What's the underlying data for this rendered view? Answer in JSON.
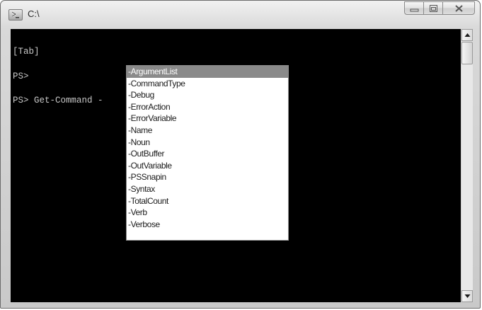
{
  "window": {
    "title": "C:\\",
    "icon": "powershell-icon"
  },
  "caption_buttons": {
    "minimize_icon": "minimize-icon",
    "maximize_icon": "maximize-icon",
    "close_icon": "close-icon"
  },
  "console": {
    "lines": [
      "[Tab]",
      "PS>",
      "PS> Get-Command -"
    ],
    "background": "#000000",
    "foreground": "#c8c8c8"
  },
  "completion": {
    "selected_index": 0,
    "items": [
      "-ArgumentList",
      "-CommandType",
      "-Debug",
      "-ErrorAction",
      "-ErrorVariable",
      "-Name",
      "-Noun",
      "-OutBuffer",
      "-OutVariable",
      "-PSSnapin",
      "-Syntax",
      "-TotalCount",
      "-Verb",
      "-Verbose"
    ]
  }
}
